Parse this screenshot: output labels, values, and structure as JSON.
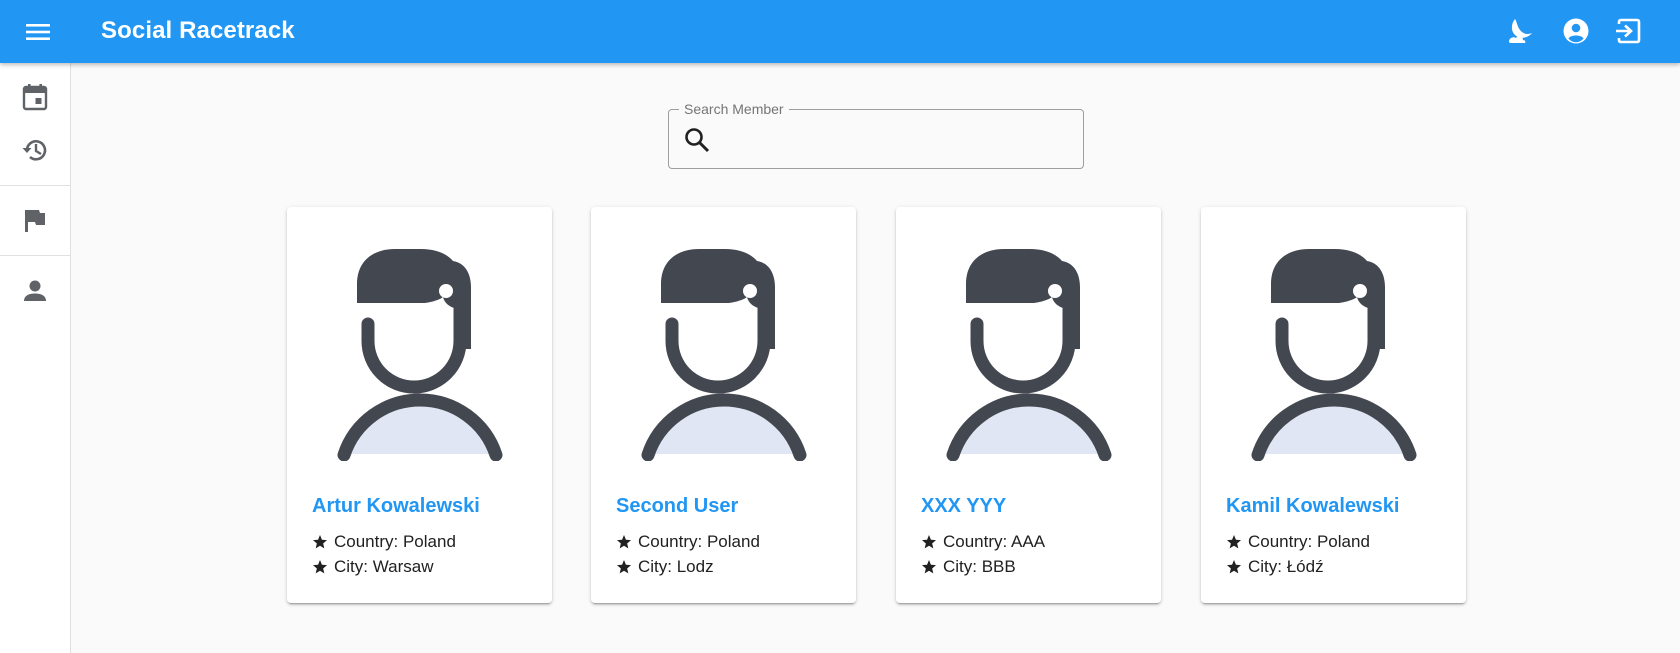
{
  "app": {
    "title": "Social Racetrack"
  },
  "header": {
    "icons": [
      "menu-icon",
      "theme-toggle-icon",
      "account-icon",
      "logout-icon"
    ]
  },
  "sidebar": {
    "items": [
      {
        "name": "calendar",
        "icon": "calendar-icon"
      },
      {
        "name": "history",
        "icon": "history-icon"
      },
      {
        "name": "races",
        "icon": "flag-icon"
      },
      {
        "name": "members",
        "icon": "person-icon"
      }
    ]
  },
  "search": {
    "label": "Search Member",
    "value": ""
  },
  "members": [
    {
      "name": "Artur Kowalewski",
      "country": "Country: Poland",
      "city": "City: Warsaw"
    },
    {
      "name": "Second User",
      "country": "Country: Poland",
      "city": "City: Lodz"
    },
    {
      "name": "XXX YYY",
      "country": "Country: AAA",
      "city": "City: BBB"
    },
    {
      "name": "Kamil Kowalewski",
      "country": "Country: Poland",
      "city": "City: Łódź"
    }
  ],
  "colors": {
    "primary": "#2196f3",
    "avatar_dark": "#434850",
    "avatar_light": "#e0e6f3"
  }
}
